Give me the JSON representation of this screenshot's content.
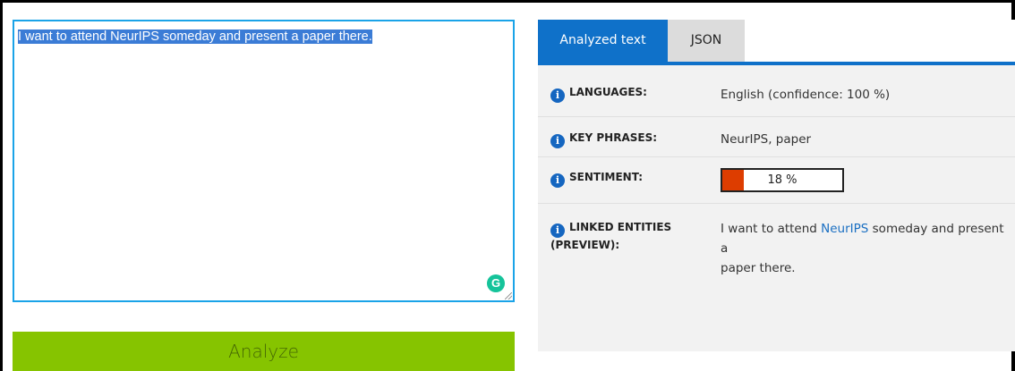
{
  "editor": {
    "text": "I want to attend NeurIPS someday and present a paper there.",
    "grammarly_glyph": "G"
  },
  "analyze_button": {
    "label": "Analyze"
  },
  "tabs": [
    {
      "label": "Analyzed text",
      "active": true
    },
    {
      "label": "JSON",
      "active": false
    }
  ],
  "results": {
    "languages": {
      "label": "LANGUAGES:",
      "value": "English (confidence: 100 %)"
    },
    "key_phrases": {
      "label": "KEY PHRASES:",
      "value": "NeurIPS, paper"
    },
    "sentiment": {
      "label": "SENTIMENT:",
      "value_text": "18 %",
      "value": 0.18
    },
    "linked_entities": {
      "label_line1": "LINKED ENTITIES",
      "label_line2": "(PREVIEW):",
      "before": "I want to attend ",
      "entity": "NeurIPS",
      "after_line1": " someday and present a",
      "line2": "paper there."
    }
  },
  "colors": {
    "accent_blue": "#0f71c9",
    "analyze_green": "#86c400",
    "sentiment_fill": "#dd3d00",
    "editor_border": "#1aa3e8"
  },
  "icons": {
    "info": "info-icon",
    "grammarly": "grammarly-icon"
  }
}
